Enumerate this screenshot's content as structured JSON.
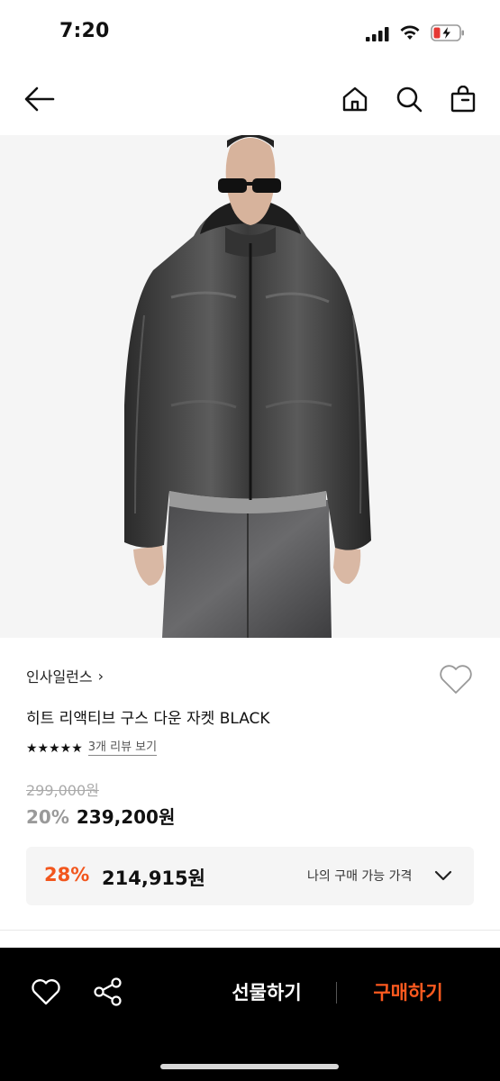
{
  "status_bar": {
    "time": "7:20"
  },
  "nav": {
    "icons": [
      "back-arrow-icon",
      "home-icon",
      "search-icon",
      "shopping-bag-icon"
    ]
  },
  "product": {
    "brand": "인사일런스",
    "brand_chevron": "›",
    "title": "히트 리액티브 구스 다운 자켓 BLACK",
    "stars": "★★★★★",
    "review_link": "3개 리뷰 보기",
    "original_price": "299,000원",
    "discount": "20%",
    "price": "239,200원"
  },
  "my_buy": {
    "discount": "28%",
    "price": "214,915원",
    "label": "나의 구매 가능 가격"
  },
  "bottom_bar": {
    "gift_label": "선물하기",
    "buy_label": "구매하기"
  },
  "colors": {
    "accent": "#ff5a1f",
    "discount_gray": "#9a9a9a",
    "bottom_bar_bg": "#000000"
  }
}
